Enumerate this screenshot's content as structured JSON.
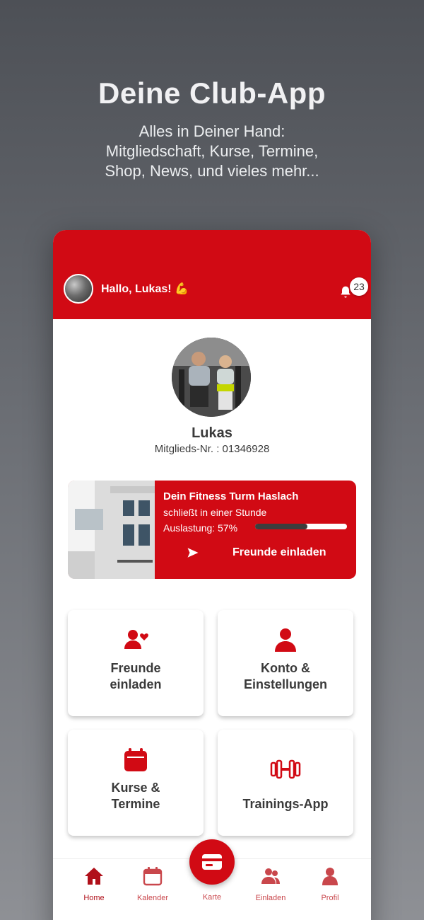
{
  "promo": {
    "title": "Deine Club-App",
    "subtitle_lines": [
      "Alles in Deiner Hand:",
      "Mitgliedschaft, Kurse, Termine,",
      "Shop, News, und vieles mehr..."
    ]
  },
  "header": {
    "greeting": "Hallo, Lukas! 💪",
    "notification_count": "23"
  },
  "profile": {
    "name": "Lukas",
    "member_number": "Mitglieds-Nr. : 01346928"
  },
  "studio": {
    "name": "Dein Fitness Turm Haslach",
    "status": "schließt in einer Stunde",
    "load_label": "Auslastung: 57%",
    "load_fraction": 0.57,
    "invite_label": "Freunde einladen"
  },
  "tiles": [
    {
      "label_line1": "Freunde",
      "label_line2": "einladen",
      "icon": "invite-friend-icon"
    },
    {
      "label_line1": "Konto &",
      "label_line2": "Einstellungen",
      "icon": "person-icon"
    },
    {
      "label_line1": "Kurse &",
      "label_line2": "Termine",
      "icon": "calendar-icon"
    },
    {
      "label_line1": "Trainings-App",
      "label_line2": "",
      "icon": "dumbbell-icon"
    }
  ],
  "nav": {
    "home": "Home",
    "calendar": "Kalender",
    "card": "Karte",
    "invite": "Einladen",
    "profile": "Profil"
  },
  "colors": {
    "brand_red": "#d10a14",
    "text_dark": "#3a3a3a",
    "nav_inactive": "#c9474c"
  }
}
